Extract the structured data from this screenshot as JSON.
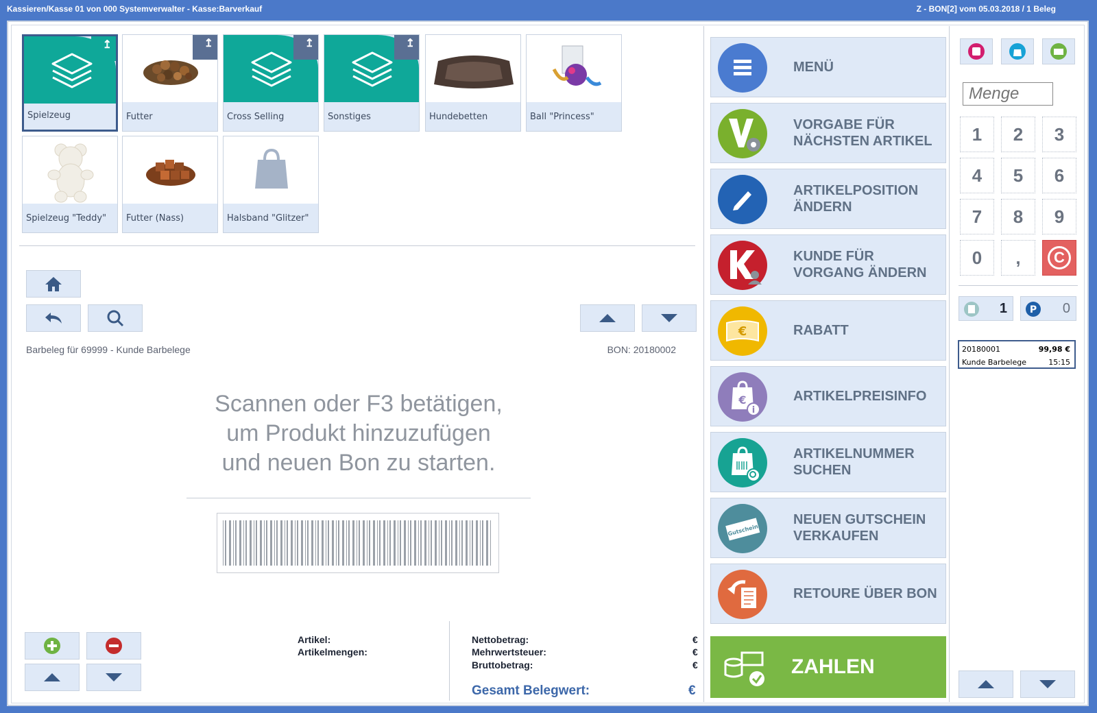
{
  "window": {
    "title_left": "Kassieren/Kasse 01 von 000 Systemverwalter - Kasse:Barverkauf",
    "title_right": "Z - BON[2] vom 05.03.2018 / 1 Beleg"
  },
  "tiles": [
    {
      "label": "Spielzeug",
      "icon": "layers-icon"
    },
    {
      "label": "Futter",
      "icon": "dog-food-image"
    },
    {
      "label": "Cross Selling",
      "icon": "layers-icon"
    },
    {
      "label": "Sonstiges",
      "icon": "layers-icon"
    },
    {
      "label": "Hundebetten",
      "icon": "dog-bed-image"
    },
    {
      "label": "Ball \"Princess\"",
      "icon": "toy-ball-image"
    },
    {
      "label": "Spielzeug \"Teddy\"",
      "icon": "teddy-bear-image"
    },
    {
      "label": "Futter (Nass)",
      "icon": "wet-food-image"
    },
    {
      "label": "Halsband \"Glitzer\"",
      "icon": "bag-icon"
    }
  ],
  "receipt": {
    "customer_line": "Barbeleg für 69999 - Kunde Barbelege",
    "bon_number": "BON: 20180002",
    "prompt": [
      "Scannen oder F3 betätigen,",
      "um Produkt hinzuzufügen",
      "und neuen Bon zu starten."
    ]
  },
  "summary": {
    "artikel": "Artikel:",
    "artikelmengen": "Artikelmengen:",
    "netto": "Nettobetrag:",
    "mwst": "Mehrwertsteuer:",
    "brutto": "Bruttobetrag:",
    "currency": "€",
    "gesamt": "Gesamt Belegwert:"
  },
  "actions": [
    {
      "label": "MENÜ",
      "icon": "menu-icon",
      "color": "#4a7bd0"
    },
    {
      "label": "VORGABE FÜR NÄCHSTEN ARTIKEL",
      "icon": "settings-v-icon",
      "color": "#7ab02d"
    },
    {
      "label": "ARTIKELPOSITION ÄNDERN",
      "icon": "pencil-icon",
      "color": "#2363b4"
    },
    {
      "label": "KUNDE FÜR VORGANG ÄNDERN",
      "icon": "customer-k-icon",
      "color": "#c5202d"
    },
    {
      "label": "RABATT",
      "icon": "euro-banknote-icon",
      "color": "#f0b800"
    },
    {
      "label": "ARTIKELPREISINFO",
      "icon": "price-info-icon",
      "color": "#8f7dbb"
    },
    {
      "label": "ARTIKELNUMMER SUCHEN",
      "icon": "barcode-bag-icon",
      "color": "#17a393"
    },
    {
      "label": "NEUEN GUTSCHEIN VERKAUFEN",
      "icon": "voucher-icon",
      "color": "#4e8d9c"
    },
    {
      "label": "RETOURE ÜBER BON",
      "icon": "return-icon",
      "color": "#e06a3f"
    }
  ],
  "pay": {
    "label": "ZAHLEN",
    "icon": "coins-check-icon",
    "color": "#7ab845"
  },
  "right": {
    "menge_placeholder": "Menge",
    "keys": [
      "1",
      "2",
      "3",
      "4",
      "5",
      "6",
      "7",
      "8",
      "9",
      "0",
      ",",
      "C"
    ],
    "receipts_count": "1",
    "parked_count": "0",
    "last_bon": {
      "number": "20180001",
      "amount": "99,98 €",
      "customer": "Kunde Barbelege",
      "time": "15:15"
    }
  },
  "voucher_text": "Gutschein"
}
